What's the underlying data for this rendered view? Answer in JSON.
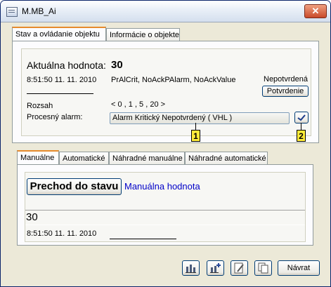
{
  "window": {
    "title": "M.MB_Ai"
  },
  "tabs_top": [
    {
      "label": "Stav a ovládanie objektu"
    },
    {
      "label": "Informácie o objekte"
    }
  ],
  "status": {
    "current_value_label": "Aktuálna hodnota:",
    "current_value": "30",
    "timestamp": "8:51:50 11. 11. 2010",
    "flags": "PrAlCrit, NoAckPAlarm, NoAckValue",
    "unconfirmed_label": "Nepotvrdená",
    "confirm_button": "Potvrdenie",
    "range_label": "Rozsah",
    "range_value": "< 0 , 1 , 5 , 20 >",
    "process_alarm_label": "Procesný alarm:",
    "process_alarm_value": "Alarm Kritický Nepotvrdený ( VHL )",
    "marker_1": "1",
    "marker_2": "2"
  },
  "tabs_bottom": [
    {
      "label": "Manuálne"
    },
    {
      "label": "Automatické"
    },
    {
      "label": "Náhradné manuálne"
    },
    {
      "label": "Náhradné automatické"
    }
  ],
  "manual": {
    "transition_button": "Prechod do stavu",
    "manual_value_label": "Manuálna hodnota",
    "value": "30",
    "timestamp": "8:51:50 11. 11. 2010"
  },
  "footer": {
    "return_button": "Návrat"
  }
}
